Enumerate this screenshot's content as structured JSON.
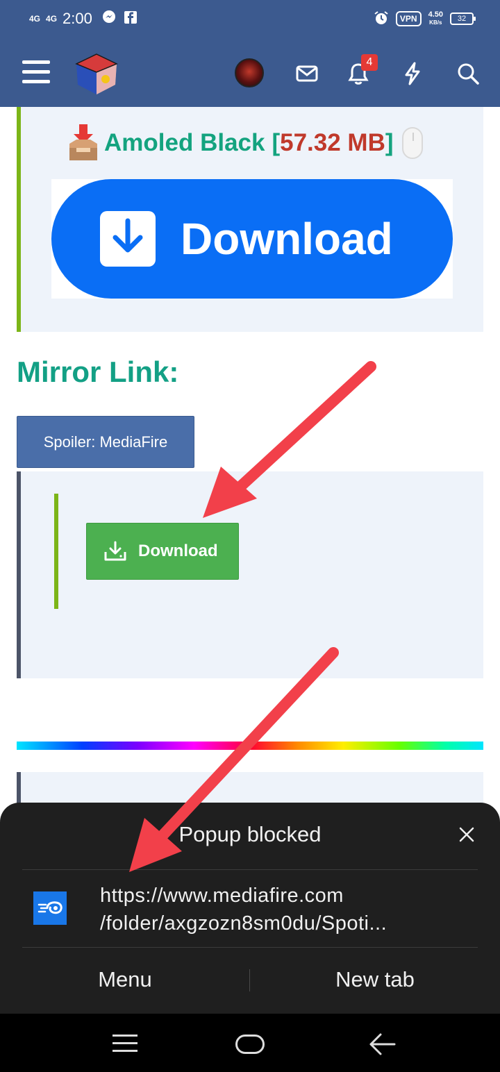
{
  "status_bar": {
    "signal1": "4G",
    "signal2": "4G",
    "time": "2:00",
    "vpn": "VPN",
    "net_speed_value": "4.50",
    "net_speed_unit": "KB/s",
    "battery": "32"
  },
  "header": {
    "notification_count": "4",
    "icons": [
      "menu-icon",
      "site-logo",
      "avatar",
      "mail-icon",
      "bell-icon",
      "lightning-icon",
      "search-icon"
    ]
  },
  "download_card": {
    "file_name": "Amoled Black",
    "bracket_open": "[",
    "file_size": "57.32 MB",
    "bracket_close": "]",
    "button_label": "Download"
  },
  "mirror": {
    "heading": "Mirror Link:",
    "spoiler_label": "Spoiler: MediaFire",
    "download_label": "Download"
  },
  "popup": {
    "title": "Popup blocked",
    "url_line1": "https://www.mediafire.com",
    "url_line2": "/folder/axgzozn8sm0du/Spoti...",
    "menu_label": "Menu",
    "new_tab_label": "New tab"
  },
  "colors": {
    "header_bg": "#3c5a8f",
    "accent_green": "#14a37f",
    "size_red": "#c0392b",
    "download_blue": "#0a6ef5",
    "download_green": "#4cb050",
    "arrow_red": "#f2404a"
  }
}
